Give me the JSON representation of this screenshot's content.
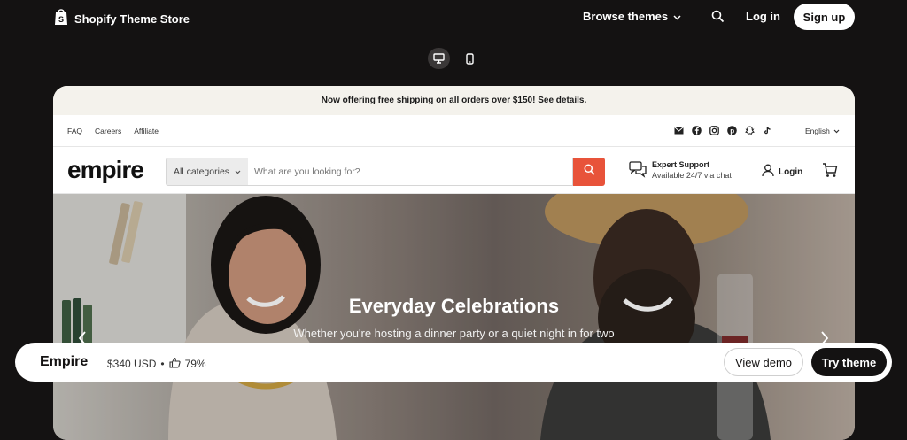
{
  "topbar": {
    "brand": "Shopify Theme Store",
    "browse": "Browse themes",
    "login": "Log in",
    "signup": "Sign up"
  },
  "devices": [
    "desktop-icon",
    "mobile-icon"
  ],
  "preview": {
    "announcement": "Now offering free shipping on all orders over $150! See details.",
    "utility_links": [
      "FAQ",
      "Careers",
      "Affiliate"
    ],
    "socials": [
      "mail-icon",
      "facebook-icon",
      "instagram-icon",
      "pinterest-icon",
      "snapchat-icon",
      "tiktok-icon"
    ],
    "language": "English",
    "logo": "empire",
    "search": {
      "category": "All categories",
      "placeholder": "What are you looking for?"
    },
    "support": {
      "title": "Expert Support",
      "subtitle": "Available 24/7 via chat"
    },
    "login": "Login",
    "hero": {
      "title": "Everyday Celebrations",
      "subtitle": "Whether you're hosting a dinner party or a quiet night in for two"
    }
  },
  "theme": {
    "name": "Empire",
    "price": "$340 USD",
    "separator": "•",
    "rating": "79%",
    "view_demo": "View demo",
    "try_theme": "Try theme"
  },
  "colors": {
    "accent": "#e8533a",
    "dark": "#141212",
    "announcement_bg": "#f4f2ec"
  }
}
